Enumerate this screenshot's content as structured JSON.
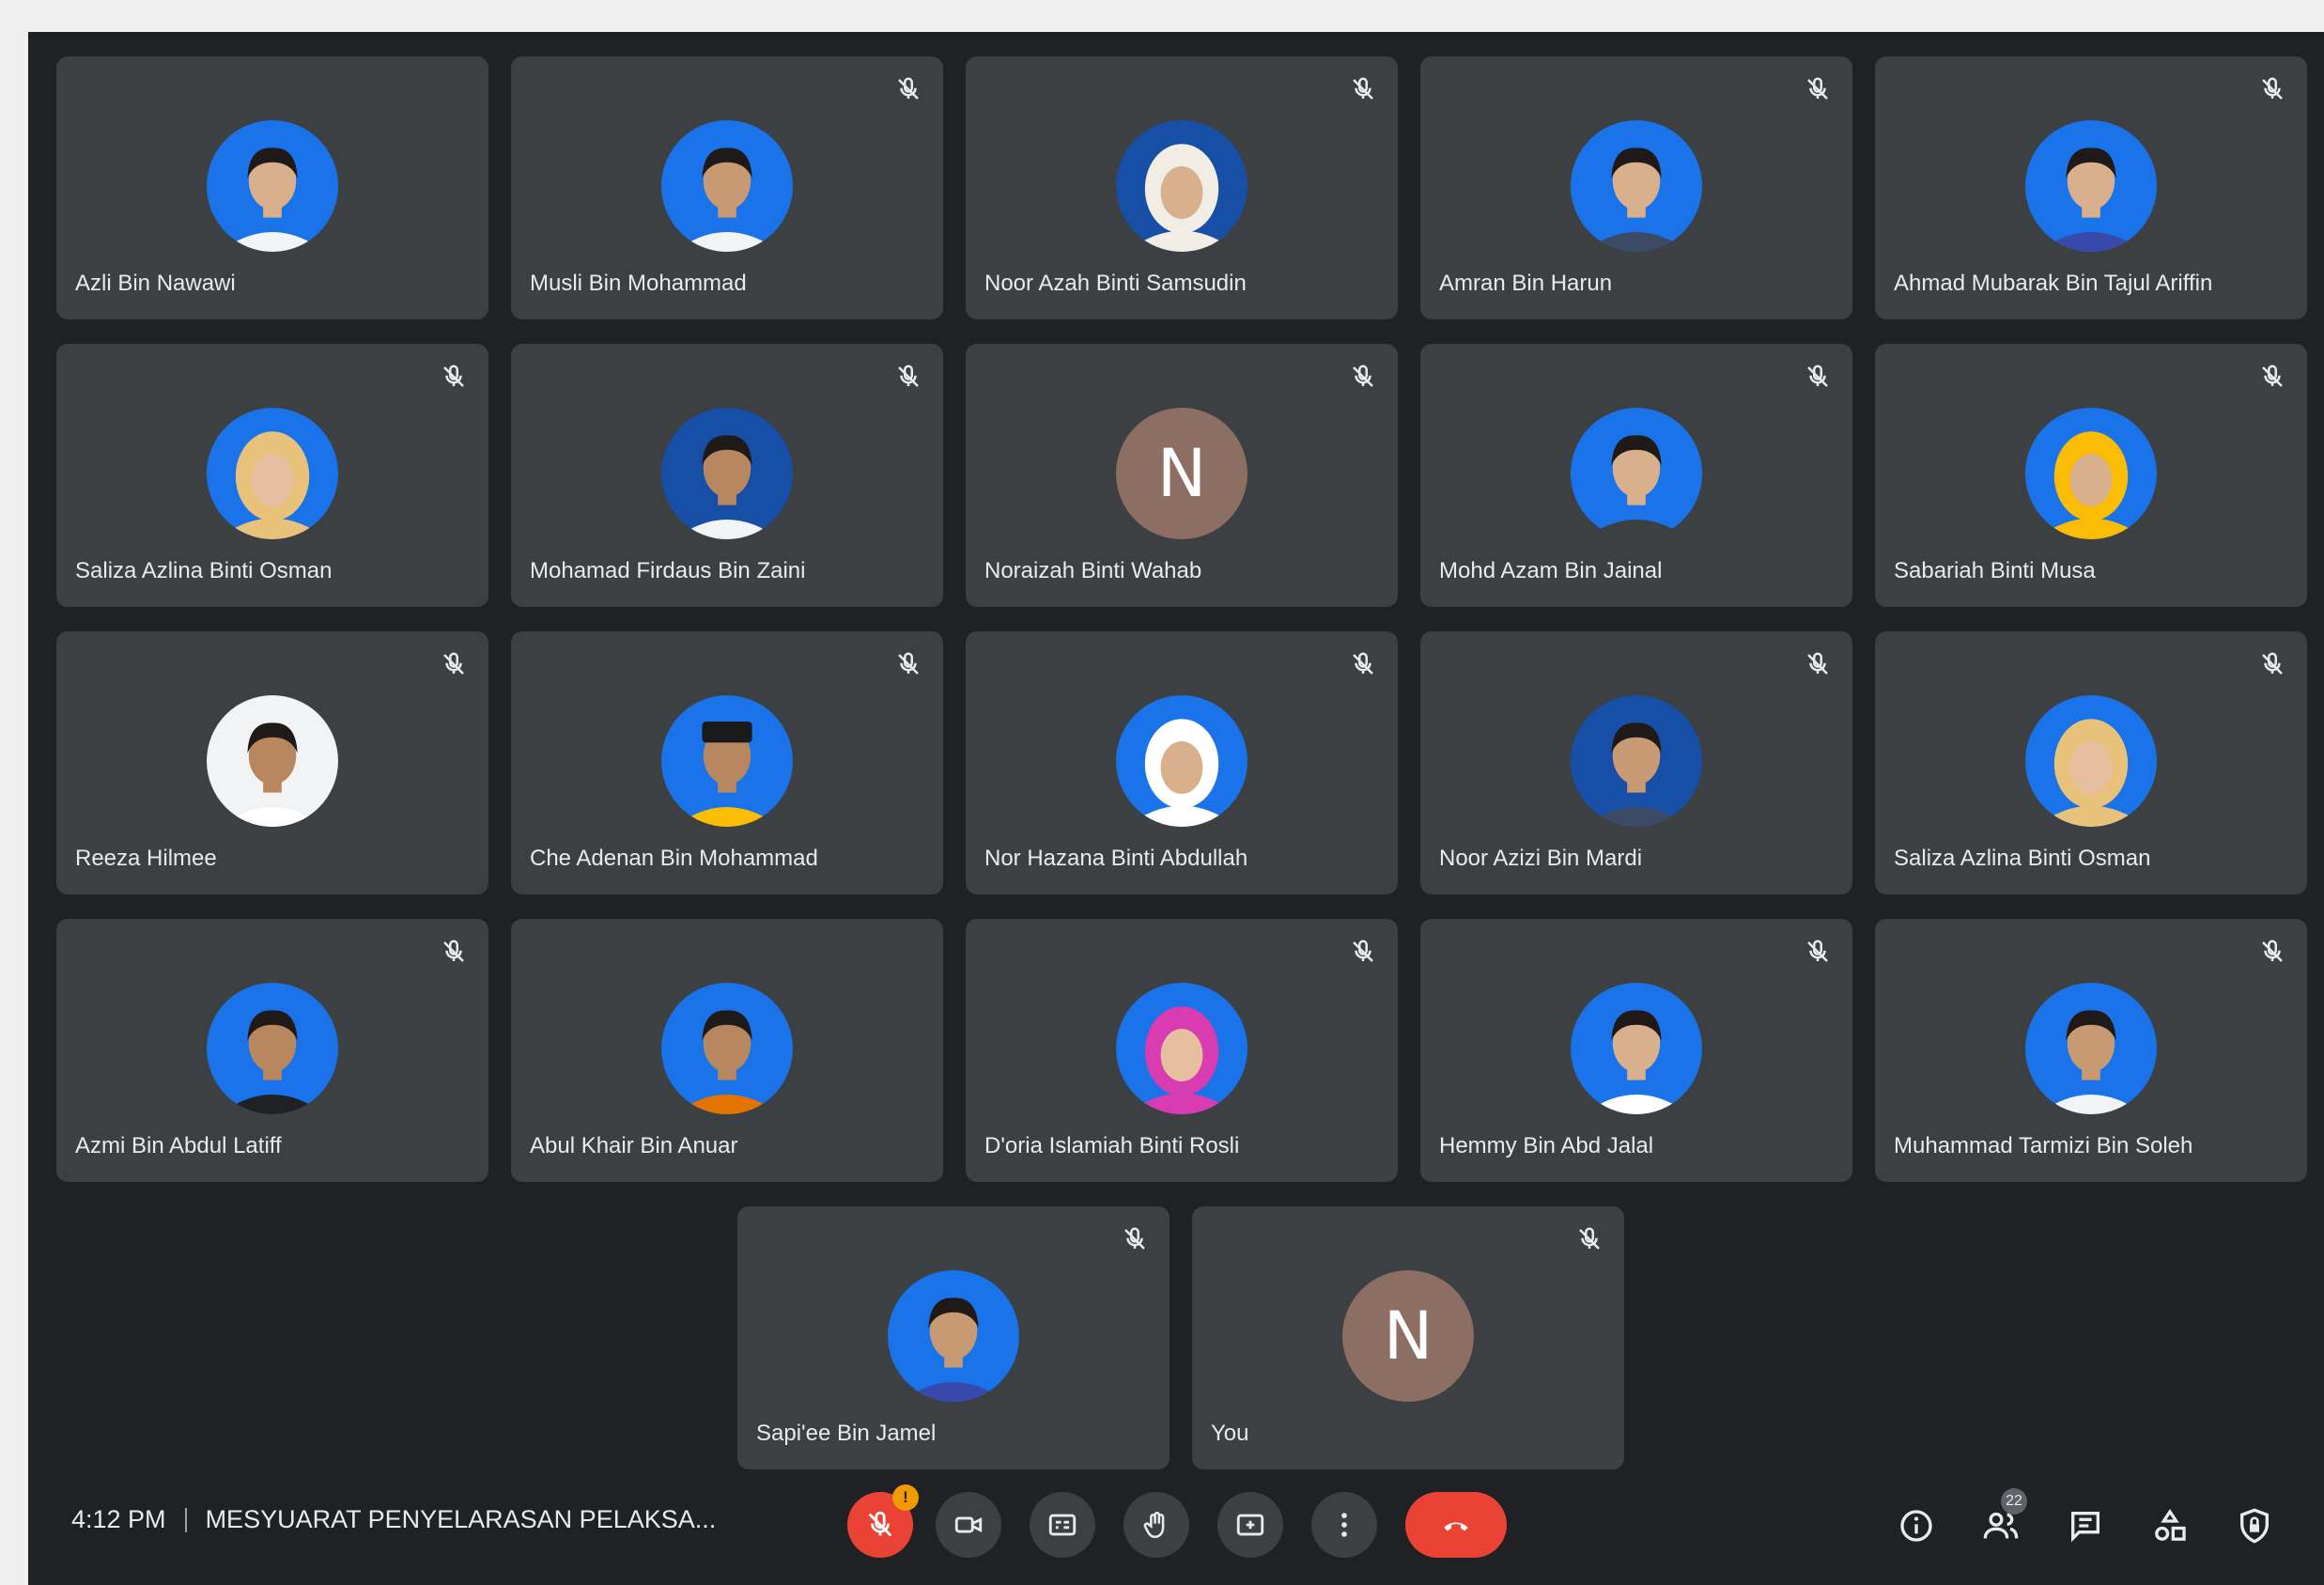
{
  "participants": [
    {
      "name": "Azli Bin Nawawi",
      "type": "photo",
      "bg": "#1a73e8",
      "skin": "#d9b08c",
      "head": "hair",
      "top": "#f1f3f4",
      "muted": false
    },
    {
      "name": "Musli Bin Mohammad",
      "type": "photo",
      "bg": "#1a73e8",
      "skin": "#c89a74",
      "head": "hair",
      "top": "#f1f3f4",
      "muted": true
    },
    {
      "name": "Noor Azah Binti Samsudin",
      "type": "photo",
      "bg": "#174ea6",
      "skin": "#d9b08c",
      "head": "hijab",
      "hijab": "#f1ece4",
      "top": "#f1ece4",
      "muted": true
    },
    {
      "name": "Amran Bin Harun",
      "type": "photo",
      "bg": "#1a73e8",
      "skin": "#d9b08c",
      "head": "hair",
      "top": "#3c4a66",
      "muted": true
    },
    {
      "name": "Ahmad Mubarak Bin Tajul Ariffin",
      "type": "photo",
      "bg": "#1a73e8",
      "skin": "#d9b08c",
      "head": "hair",
      "top": "#3949ab",
      "muted": true
    },
    {
      "name": "Saliza Azlina Binti Osman",
      "type": "photo",
      "bg": "#1a73e8",
      "skin": "#e6bfa0",
      "head": "hijab",
      "hijab": "#e8c27a",
      "top": "#e8c27a",
      "muted": true
    },
    {
      "name": "Mohamad Firdaus Bin Zaini",
      "type": "photo",
      "bg": "#174ea6",
      "skin": "#b9875f",
      "head": "hair",
      "top": "#f1f3f4",
      "muted": true
    },
    {
      "name": "Noraizah Binti Wahab",
      "type": "letter",
      "letter": "N",
      "muted": true
    },
    {
      "name": "Mohd Azam Bin Jainal",
      "type": "photo",
      "bg": "#1a73e8",
      "skin": "#d9b08c",
      "head": "hair",
      "top": "#3c4043",
      "muted": true
    },
    {
      "name": "Sabariah Binti Musa",
      "type": "photo",
      "bg": "#1a73e8",
      "skin": "#d9b08c",
      "head": "hijab",
      "hijab": "#fbbc04",
      "top": "#fbbc04",
      "muted": true
    },
    {
      "name": "Reeza Hilmee",
      "type": "photo",
      "bg": "#f1f3f4",
      "skin": "#b9875f",
      "head": "hair",
      "top": "#ffffff",
      "muted": true
    },
    {
      "name": "Che Adenan Bin Mohammad",
      "type": "photo",
      "bg": "#1a73e8",
      "skin": "#b9875f",
      "head": "songkok",
      "top": "#fbbc04",
      "muted": true
    },
    {
      "name": "Nor Hazana Binti Abdullah",
      "type": "photo",
      "bg": "#1a73e8",
      "skin": "#d9b08c",
      "head": "hijab",
      "hijab": "#ffffff",
      "top": "#ffffff",
      "muted": true
    },
    {
      "name": "Noor Azizi Bin Mardi",
      "type": "photo",
      "bg": "#174ea6",
      "skin": "#c89a74",
      "head": "hair",
      "top": "#3c4a66",
      "muted": true
    },
    {
      "name": "Saliza Azlina Binti Osman",
      "type": "photo",
      "bg": "#1a73e8",
      "skin": "#e6bfa0",
      "head": "hijab",
      "hijab": "#e8c27a",
      "top": "#e8c27a",
      "muted": true
    },
    {
      "name": "Azmi Bin Abdul Latiff",
      "type": "photo",
      "bg": "#1a73e8",
      "skin": "#b9875f",
      "head": "hair",
      "top": "#202124",
      "muted": true
    },
    {
      "name": "Abul Khair Bin Anuar",
      "type": "photo",
      "bg": "#1a73e8",
      "skin": "#b9875f",
      "head": "hair",
      "top": "#e37400",
      "muted": false
    },
    {
      "name": "D'oria Islamiah Binti Rosli",
      "type": "photo",
      "bg": "#1a73e8",
      "skin": "#e6bfa0",
      "head": "hijab",
      "hijab": "#d93bb0",
      "top": "#d93bb0",
      "muted": true
    },
    {
      "name": "Hemmy Bin Abd Jalal",
      "type": "photo",
      "bg": "#1a73e8",
      "skin": "#d9b08c",
      "head": "hair",
      "top": "#ffffff",
      "muted": true
    },
    {
      "name": "Muhammad Tarmizi Bin Soleh",
      "type": "photo",
      "bg": "#1a73e8",
      "skin": "#c89a74",
      "head": "hair",
      "top": "#f1f3f4",
      "muted": true
    },
    {
      "name": "Sapi'ee Bin Jamel",
      "type": "photo",
      "bg": "#1a73e8",
      "skin": "#c89a74",
      "head": "hair",
      "top": "#3949ab",
      "muted": true
    },
    {
      "name": "You",
      "type": "letter",
      "letter": "N",
      "muted": true
    }
  ],
  "bottom_bar": {
    "time": "4:12 PM",
    "meeting_title": "MESYUARAT PENYELARASAN PELAKSA...",
    "mic_badge": "!",
    "participant_count": "22",
    "controls": [
      "mic-off",
      "camera",
      "captions",
      "raise-hand",
      "present",
      "more-options",
      "leave-call"
    ],
    "right_icons": [
      "meeting-details",
      "people",
      "chat",
      "activities",
      "host-controls"
    ]
  },
  "colors": {
    "background": "#202124",
    "tile": "#3c4043",
    "leave_call": "#ea4335",
    "letter_avatar": "#8d6e63",
    "badge": "#f29900"
  }
}
